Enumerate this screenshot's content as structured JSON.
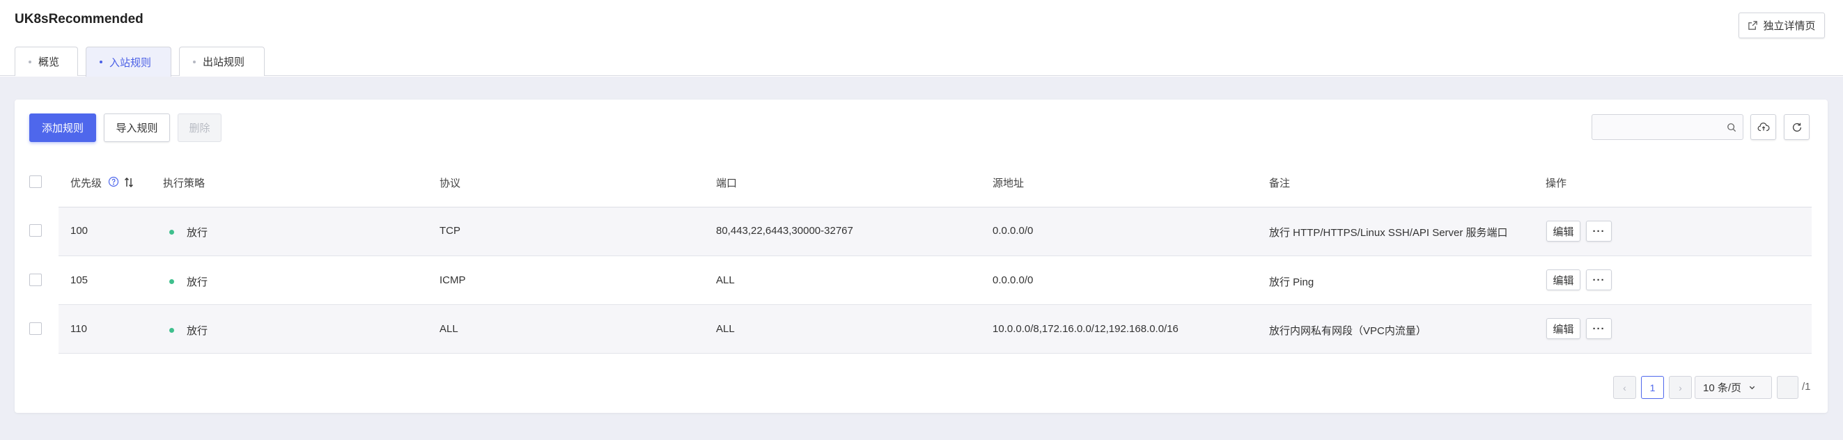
{
  "header": {
    "title": "UK8sRecommended",
    "detail_button": "独立详情页"
  },
  "tabs": [
    {
      "label": "概览",
      "active": false
    },
    {
      "label": "入站规则",
      "active": true
    },
    {
      "label": "出站规则",
      "active": false
    }
  ],
  "toolbar": {
    "add_label": "添加规则",
    "import_label": "导入规则",
    "delete_label": "删除",
    "search_placeholder": ""
  },
  "table": {
    "columns": [
      "优先级",
      "执行策略",
      "协议",
      "端口",
      "源地址",
      "备注",
      "操作"
    ],
    "rows": [
      {
        "priority": "100",
        "policy": "放行",
        "protocol": "TCP",
        "port": "80,443,22,6443,30000-32767",
        "source": "0.0.0.0/0",
        "remark": "放行 HTTP/HTTPS/Linux SSH/API Server 服务端口"
      },
      {
        "priority": "105",
        "policy": "放行",
        "protocol": "ICMP",
        "port": "ALL",
        "source": "0.0.0.0/0",
        "remark": "放行 Ping"
      },
      {
        "priority": "110",
        "policy": "放行",
        "protocol": "ALL",
        "port": "ALL",
        "source": "10.0.0.0/8,172.16.0.0/12,192.168.0.0/16",
        "remark": "放行内网私有网段（VPC内流量）"
      }
    ],
    "edit_label": "编辑",
    "more_label": "···"
  },
  "pagination": {
    "prev": "‹",
    "current": "1",
    "next": "›",
    "page_size": "10 条/页",
    "total": "/1"
  },
  "colors": {
    "primary": "#4e67ec",
    "status_green": "#3fbf8d"
  }
}
